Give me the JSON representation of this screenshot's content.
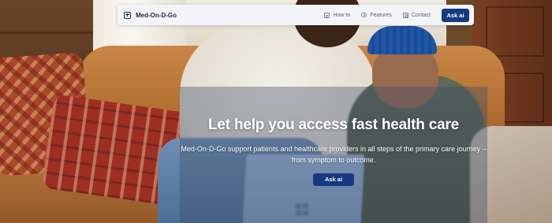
{
  "navbar": {
    "brand": "Med-On-D-Go",
    "brand_icon": "plus-square-icon",
    "links": [
      {
        "label": "How to",
        "icon": "document-icon"
      },
      {
        "label": "Features",
        "icon": "eye-icon"
      },
      {
        "label": "Contact",
        "icon": "contact-card-icon"
      }
    ],
    "cta_label": "Ask ai"
  },
  "hero": {
    "title": "Let help you access fast health care",
    "subtitle": "Med-On-D-Go support patients and healthcare providers in all steps of the primary care journey – from symptom to outcome.",
    "cta_label": "Ask ai"
  },
  "colors": {
    "primary": "#163a80",
    "navbar_bg": "#f2f4f8",
    "brand_text": "#1d2a44"
  }
}
